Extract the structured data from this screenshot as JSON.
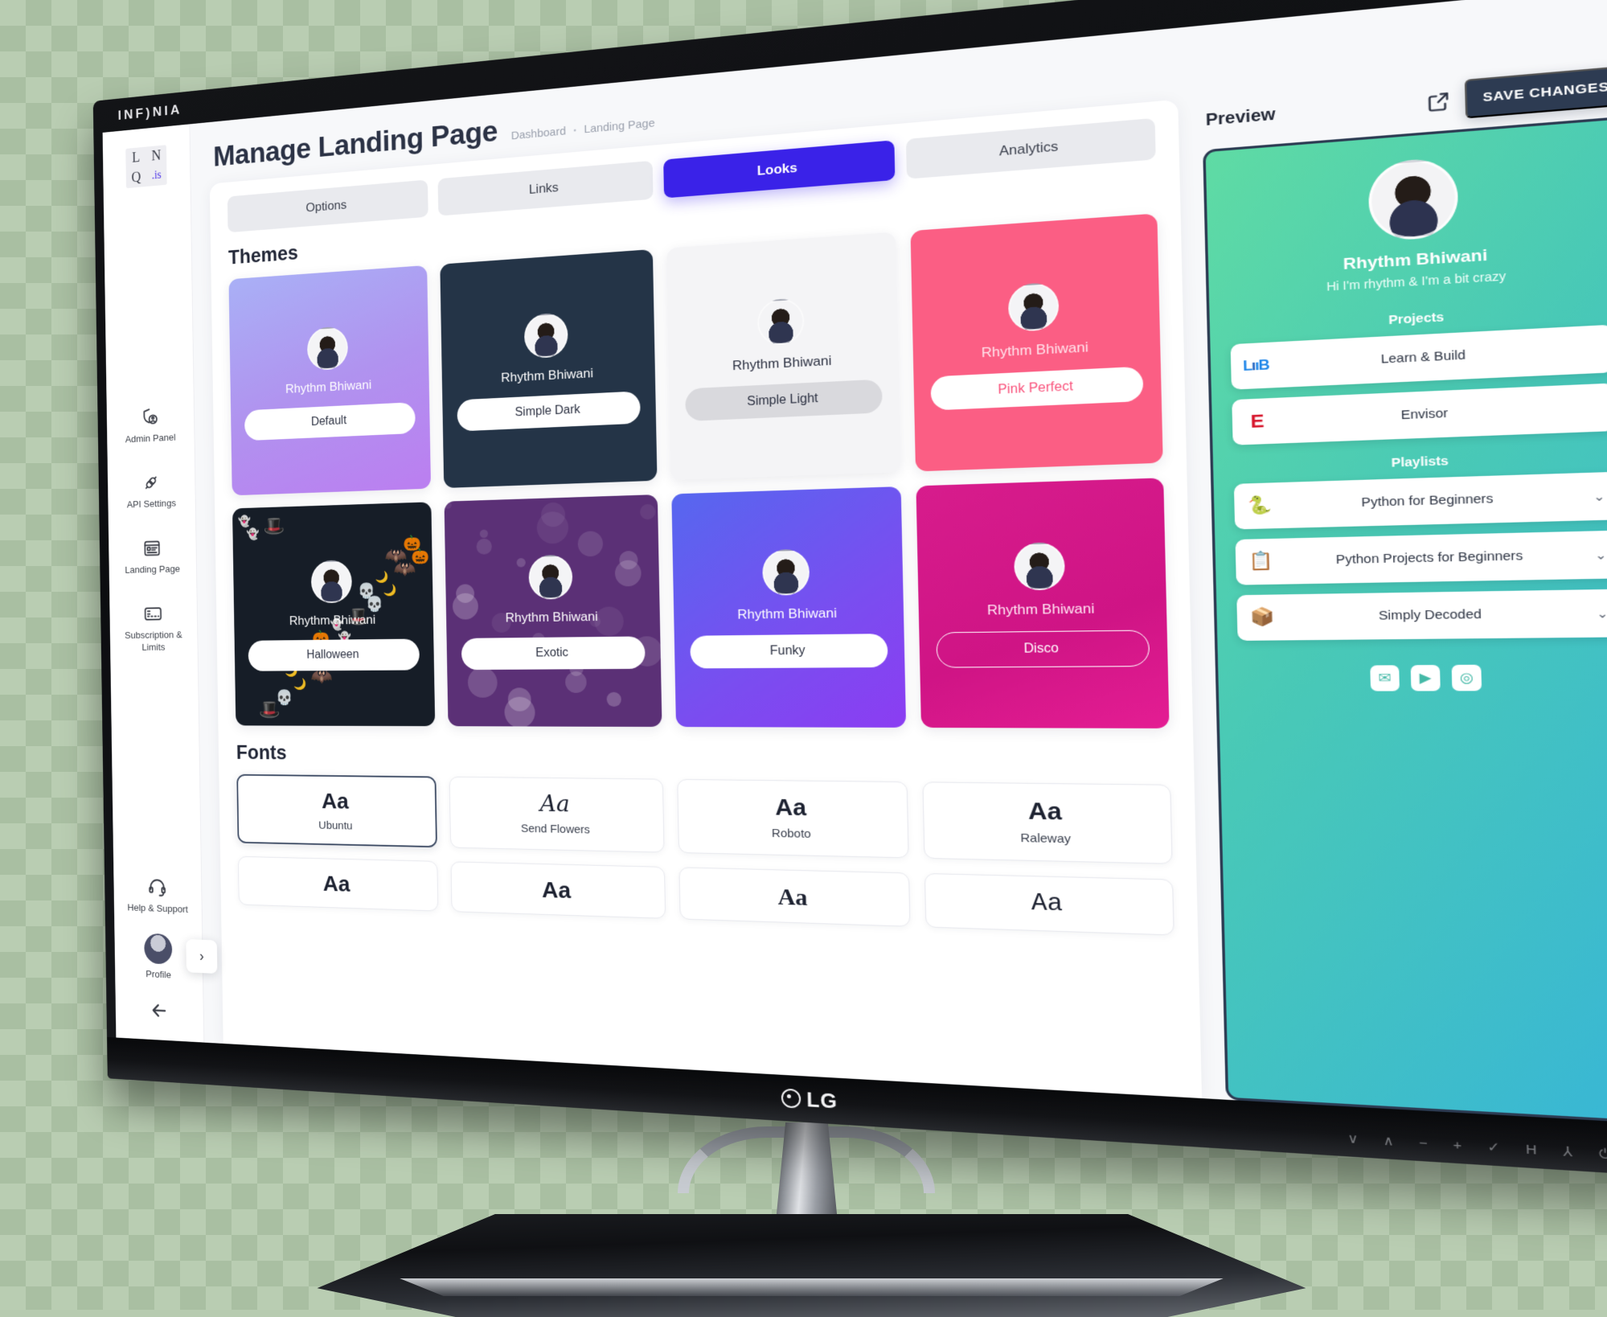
{
  "hardware": {
    "bezel_brand": "INF)NIA",
    "monitor_brand": "LG",
    "bezel_buttons": [
      "∨",
      "∧",
      "−",
      "+",
      "✓",
      "H",
      "⅄",
      "⏻"
    ]
  },
  "sidebar": {
    "logo_cells": [
      "L",
      "N",
      "Q",
      ".is"
    ],
    "items": [
      {
        "label": "Admin Panel",
        "icon": "shield-user-icon"
      },
      {
        "label": "API Settings",
        "icon": "plug-connect-icon"
      },
      {
        "label": "Landing Page",
        "icon": "page-layout-icon"
      },
      {
        "label": "Subscription & Limits",
        "icon": "credit-card-icon"
      }
    ],
    "bottom_items": [
      {
        "label": "Help & Support",
        "icon": "headset-icon"
      },
      {
        "label": "Profile",
        "icon": "avatar-icon"
      }
    ],
    "back_icon": "arrow-left-icon",
    "collapse_icon": "chevron-right-icon"
  },
  "header": {
    "title": "Manage Landing Page",
    "breadcrumb": [
      "Dashboard",
      "Landing Page"
    ],
    "breadcrumb_separator": "•"
  },
  "tabs": [
    {
      "label": "Options",
      "active": false
    },
    {
      "label": "Links",
      "active": false
    },
    {
      "label": "Looks",
      "active": true
    },
    {
      "label": "Analytics",
      "active": false
    }
  ],
  "themes_section": {
    "title": "Themes",
    "profile_name": "Rhythm Bhiwani",
    "items": [
      {
        "name": "Default",
        "card_bg": "linear-gradient(160deg,#a9b0f6 0%, #b093ef 50%, #bb7ef0 100%)",
        "name_color": "#ffffff",
        "btn_bg": "#ffffff",
        "btn_color": "#2c3142",
        "btn_border": "none"
      },
      {
        "name": "Simple Dark",
        "card_bg": "#243447",
        "name_color": "#ffffff",
        "btn_bg": "#ffffff",
        "btn_color": "#2c3142",
        "btn_border": "none"
      },
      {
        "name": "Simple Light",
        "card_bg": "#f4f4f6",
        "name_color": "#2c3142",
        "btn_bg": "#d9d9dd",
        "btn_color": "#2c3142",
        "btn_border": "none"
      },
      {
        "name": "Pink Perfect",
        "card_bg": "#fb5e84",
        "name_color": "#ffe4ec",
        "btn_bg": "#ffffff",
        "btn_color": "#f9537c",
        "btn_border": "none"
      },
      {
        "name": "Halloween",
        "card_bg": "#161d27",
        "name_color": "#ffffff",
        "btn_bg": "#ffffff",
        "btn_color": "#2c3142",
        "btn_border": "none",
        "pattern": "halloween"
      },
      {
        "name": "Exotic",
        "card_bg": "#5b3076",
        "name_color": "#ffffff",
        "btn_bg": "#ffffff",
        "btn_color": "#2c3142",
        "btn_border": "none",
        "pattern": "bokeh"
      },
      {
        "name": "Funky",
        "card_bg": "linear-gradient(145deg,#5667ef 0%, #7a4df0 60%, #8b3df2 100%)",
        "name_color": "#ffffff",
        "btn_bg": "#ffffff",
        "btn_color": "#2c3142",
        "btn_border": "none"
      },
      {
        "name": "Disco",
        "card_bg": "linear-gradient(160deg,#d71c8c 0%, #cf1485 60%, #e41d93 100%)",
        "name_color": "#ffe6f3",
        "btn_bg": "transparent",
        "btn_color": "#ffffff",
        "btn_border": "1.5px solid #ffffff"
      }
    ]
  },
  "fonts_section": {
    "title": "Fonts",
    "sample": "Aa",
    "items": [
      {
        "name": "Ubuntu",
        "style": "sans",
        "selected": true
      },
      {
        "name": "Send Flowers",
        "style": "script",
        "selected": false
      },
      {
        "name": "Roboto",
        "style": "sans",
        "selected": false
      },
      {
        "name": "Raleway",
        "style": "sans",
        "selected": false
      },
      {
        "name": "",
        "style": "sans",
        "selected": false
      },
      {
        "name": "",
        "style": "sans",
        "selected": false
      },
      {
        "name": "",
        "style": "serif",
        "selected": false
      },
      {
        "name": "",
        "style": "mono",
        "selected": false
      }
    ]
  },
  "preview": {
    "label": "Preview",
    "external_link_icon": "external-link-icon",
    "save_label": "SAVE CHANGES",
    "profile_name": "Rhythm Bhiwani",
    "bio": "Hi I'm rhythm & I'm a bit crazy",
    "projects_title": "Projects",
    "projects": [
      {
        "label": "Learn & Build",
        "icon": "lnb-logo-icon",
        "glyph": "Ln"
      },
      {
        "label": "Envisor",
        "icon": "envisor-logo-icon",
        "glyph": "E"
      }
    ],
    "playlists_title": "Playlists",
    "playlists": [
      {
        "label": "Python for Beginners",
        "icon": "python-logo-icon",
        "glyph": "🐍",
        "chevron": "⌄"
      },
      {
        "label": "Python Projects for Beginners",
        "icon": "clipboard-icon",
        "glyph": "📋",
        "chevron": "⌄"
      },
      {
        "label": "Simply Decoded",
        "icon": "package-box-icon",
        "glyph": "📦",
        "chevron": "⌄"
      }
    ],
    "socials": [
      {
        "name": "email-icon",
        "glyph": "✉"
      },
      {
        "name": "youtube-icon",
        "glyph": "▶"
      },
      {
        "name": "instagram-icon",
        "glyph": "◎"
      }
    ]
  },
  "colors": {
    "accent": "#3a22e8",
    "dark_navy": "#2d3b52",
    "preview_gradient_start": "#5fdba4",
    "preview_gradient_end": "#38b6d6"
  }
}
